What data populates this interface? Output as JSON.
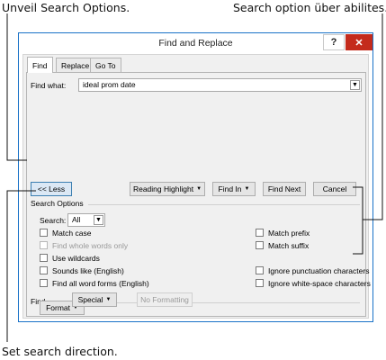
{
  "callouts": {
    "unveil": "Unveil Search Options.",
    "abilities": "Search option über abilites.",
    "direction": "Set search direction."
  },
  "dialog": {
    "title": "Find and Replace",
    "help_label": "?",
    "close_label": "✕",
    "tabs": [
      "Find",
      "Replace",
      "Go To"
    ],
    "find_what_label": "Find what:",
    "find_what_value": "ideal prom date",
    "buttons": {
      "less": "<< Less",
      "reading_highlight": "Reading Highlight",
      "find_in": "Find In",
      "find_next": "Find Next",
      "cancel": "Cancel"
    },
    "search_options_heading": "Search Options",
    "search_label": "Search:",
    "search_value": "All",
    "options_left": [
      {
        "label": "Match case",
        "enabled": true
      },
      {
        "label": "Find whole words only",
        "enabled": false
      },
      {
        "label": "Use wildcards",
        "enabled": true
      },
      {
        "label": "Sounds like (English)",
        "enabled": true
      },
      {
        "label": "Find all word forms (English)",
        "enabled": true
      }
    ],
    "options_right": [
      {
        "label": "Match prefix",
        "enabled": true
      },
      {
        "label": "Match suffix",
        "enabled": true
      },
      {
        "label": "Ignore punctuation characters",
        "enabled": true
      },
      {
        "label": "Ignore white-space characters",
        "enabled": true
      }
    ],
    "find_heading": "Find",
    "format_label": "Format",
    "special_label": "Special",
    "no_formatting_label": "No Formatting"
  },
  "colors": {
    "accent": "#1a72c8",
    "close_button": "#c42b1c"
  }
}
